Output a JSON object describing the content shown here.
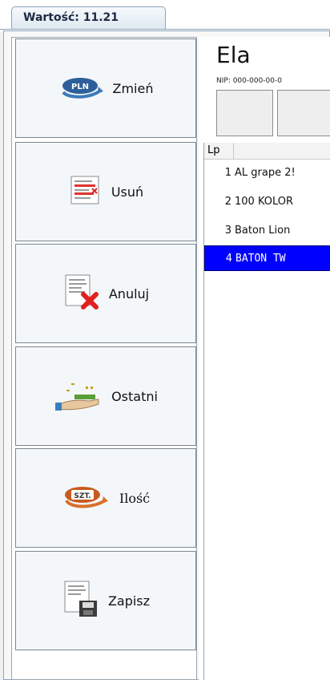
{
  "tab": {
    "label": "Wartość: 11.21"
  },
  "sidebar": {
    "buttons": [
      {
        "label": "Zmień",
        "icon": "pln-currency-icon"
      },
      {
        "label": "Usuń",
        "icon": "delete-document-icon"
      },
      {
        "label": "Anuluj",
        "icon": "cancel-document-icon"
      },
      {
        "label": "Ostatni",
        "icon": "hand-money-icon"
      },
      {
        "label": "Ilość",
        "icon": "szt-quantity-icon"
      },
      {
        "label": "Zapisz",
        "icon": "save-document-icon"
      }
    ],
    "icon_texts": {
      "pln": "PLN",
      "szt": "SZT."
    }
  },
  "customer": {
    "name": "Ela",
    "nip": "NIP: 000-000-00-0"
  },
  "table": {
    "header_lp": "Lp",
    "rows": [
      {
        "lp": "1",
        "name": "AL grape 2!"
      },
      {
        "lp": "2",
        "name": "100 KOLOR"
      },
      {
        "lp": "3",
        "name": "Baton Lion"
      },
      {
        "lp": "4",
        "name": "BATON TW",
        "selected": true
      }
    ]
  },
  "colors": {
    "selection": "#0000ff",
    "border": "#8ea3bb"
  }
}
